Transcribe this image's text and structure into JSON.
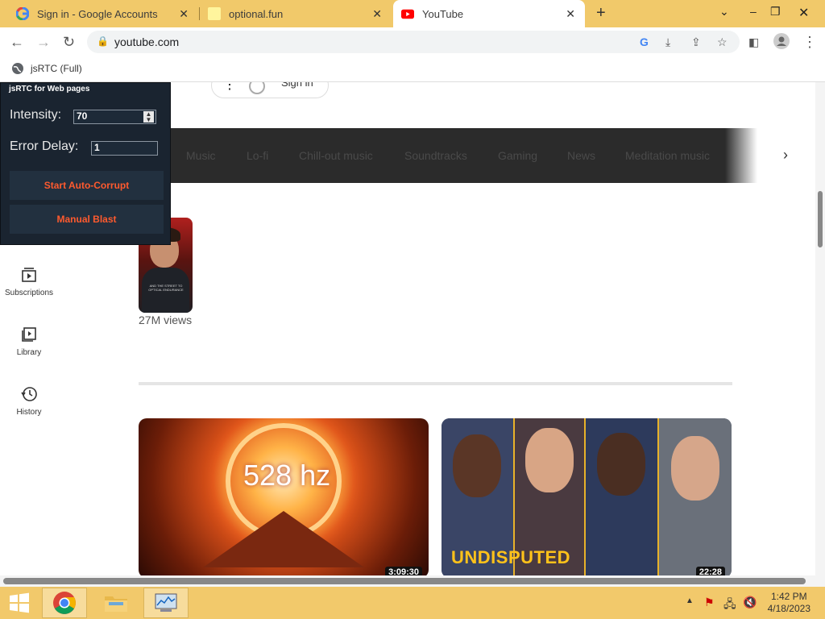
{
  "browser": {
    "tabs": [
      {
        "label": "Sign in - Google Accounts",
        "icon": "google-icon",
        "active": false
      },
      {
        "label": "optional.fun",
        "icon": "page-icon",
        "active": false
      },
      {
        "label": "YouTube",
        "icon": "youtube-icon",
        "active": true
      }
    ],
    "new_tab_label": "+",
    "url": "youtube.com",
    "bookmark": "jsRTC (Full)"
  },
  "youtube": {
    "signin": "Sign in",
    "chips": [
      "Music",
      "Lo-fi",
      "Chill-out music",
      "Soundtracks",
      "Gaming",
      "News",
      "Meditation music"
    ],
    "sidebar": [
      {
        "label": "Subscriptions",
        "icon": "subscriptions-icon"
      },
      {
        "label": "Library",
        "icon": "library-icon"
      },
      {
        "label": "History",
        "icon": "history-icon"
      }
    ],
    "short_views": "27M views",
    "short_caption": "AND THE STREET TO OPTICAL ENDURANCE",
    "videos": [
      {
        "thumb_text": "528 hz",
        "duration": "3:09:30"
      },
      {
        "thumb_text": "UNDISPUTED",
        "duration": "22:28"
      }
    ]
  },
  "jsrtc": {
    "title": "jsRTC for Web pages",
    "intensity_label": "Intensity:",
    "intensity_value": "70",
    "error_delay_label": "Error Delay:",
    "error_delay_value": "1",
    "auto_button": "Start Auto-Corrupt",
    "manual_button": "Manual Blast"
  },
  "taskbar": {
    "time": "1:42 PM",
    "date": "4/18/2023"
  },
  "colors": {
    "chrome_frame": "#f1c96a",
    "taskbar": "#f2c96b",
    "panel": "#1a2430",
    "panel_button_text": "#ff5a2e"
  }
}
